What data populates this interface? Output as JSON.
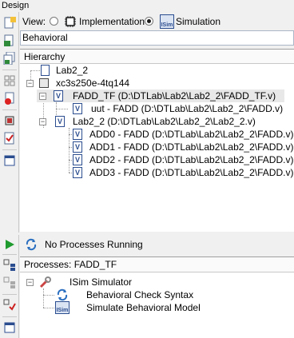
{
  "window": {
    "title": "Design"
  },
  "view": {
    "label": "View:",
    "implementation_label": "Implementation",
    "simulation_label": "Simulation",
    "selected": "Simulation",
    "simulation_icon_text": "ISim"
  },
  "combo": {
    "value": "Behavioral"
  },
  "hierarchy": {
    "header": "Hierarchy",
    "nodes": [
      {
        "label": "Lab2_2"
      },
      {
        "label": "xc3s250e-4tq144"
      },
      {
        "label": "FADD_TF (D:\\DTLab\\Lab2\\Lab2_2\\FADD_TF.v)"
      },
      {
        "label": "uut - FADD (D:\\DTLab\\Lab2\\Lab2_2\\FADD.v)"
      },
      {
        "label": "Lab2_2 (D:\\DTLab\\Lab2\\Lab2_2\\Lab2_2.v)"
      },
      {
        "label": "ADD0 - FADD (D:\\DTLab\\Lab2\\Lab2_2\\FADD.v)"
      },
      {
        "label": "ADD1 - FADD (D:\\DTLab\\Lab2\\Lab2_2\\FADD.v)"
      },
      {
        "label": "ADD2 - FADD (D:\\DTLab\\Lab2\\Lab2_2\\FADD.v)"
      },
      {
        "label": "ADD3 - FADD (D:\\DTLab\\Lab2\\Lab2_2\\FADD.v)"
      }
    ]
  },
  "processes": {
    "status": "No Processes Running",
    "header": "Processes: FADD_TF",
    "items": [
      {
        "label": "ISim Simulator"
      },
      {
        "label": "Behavioral Check Syntax"
      },
      {
        "label": "Simulate Behavioral Model",
        "icon_text": "ISim"
      }
    ]
  },
  "colors": {
    "accent": "#2b4d8f",
    "run_green": "#1f9a2e"
  }
}
